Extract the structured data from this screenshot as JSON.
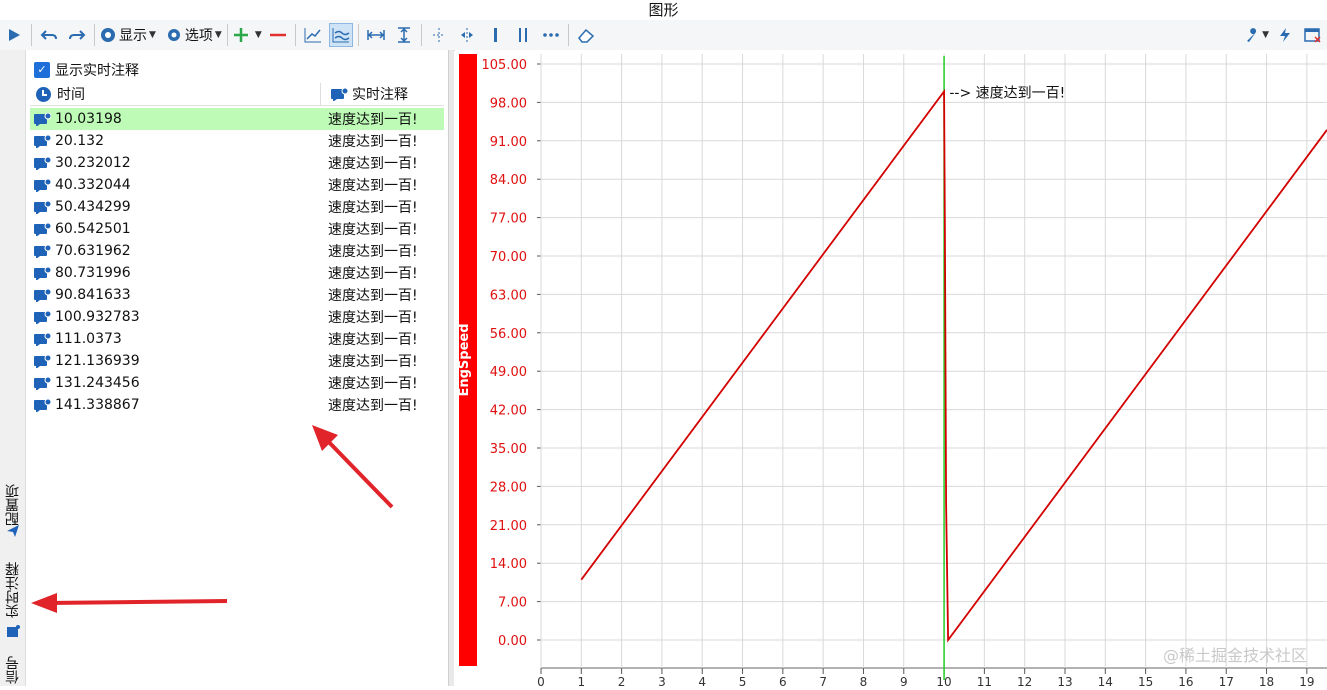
{
  "window": {
    "title": "图形"
  },
  "toolbar": {
    "display_label": "显示",
    "options_label": "选项",
    "icons": [
      "play-icon",
      "undo-icon",
      "redo-icon",
      "display-icon",
      "options-gear-icon",
      "add-icon",
      "remove-icon",
      "line-chart-icon",
      "multi-line-icon",
      "fit-width-icon",
      "fit-height-icon",
      "cursor-icon",
      "cursor-cross-icon",
      "single-bar-icon",
      "double-bar-icon",
      "more-icon",
      "eraser-icon",
      "wrench-icon",
      "lightning-icon",
      "close-window-icon"
    ]
  },
  "side_tabs": {
    "config": "配置项",
    "realtime_annot": "实时注释",
    "signal": "信号"
  },
  "annotations": {
    "show_checkbox_label": "显示实时注释",
    "col_time": "时间",
    "col_note": "实时注释",
    "rows": [
      {
        "time": "10.03198",
        "note": "速度达到一百!"
      },
      {
        "time": "20.132",
        "note": "速度达到一百!"
      },
      {
        "time": "30.232012",
        "note": "速度达到一百!"
      },
      {
        "time": "40.332044",
        "note": "速度达到一百!"
      },
      {
        "time": "50.434299",
        "note": "速度达到一百!"
      },
      {
        "time": "60.542501",
        "note": "速度达到一百!"
      },
      {
        "time": "70.631962",
        "note": "速度达到一百!"
      },
      {
        "time": "80.731996",
        "note": "速度达到一百!"
      },
      {
        "time": "90.841633",
        "note": "速度达到一百!"
      },
      {
        "time": "100.932783",
        "note": "速度达到一百!"
      },
      {
        "time": "111.0373",
        "note": "速度达到一百!"
      },
      {
        "time": "121.136939",
        "note": "速度达到一百!"
      },
      {
        "time": "131.243456",
        "note": "速度达到一百!"
      },
      {
        "time": "141.338867",
        "note": "速度达到一百!"
      }
    ]
  },
  "chart_data": {
    "type": "line",
    "ylabel": "EngSpeed",
    "ylim": [
      0,
      105
    ],
    "yticks": [
      "0.00",
      "7.00",
      "14.00",
      "21.00",
      "28.00",
      "35.00",
      "42.00",
      "49.00",
      "56.00",
      "63.00",
      "70.00",
      "77.00",
      "84.00",
      "91.00",
      "98.00",
      "105.00"
    ],
    "xlim": [
      0,
      19.5
    ],
    "xticks": [
      0,
      1,
      2,
      3,
      4,
      5,
      6,
      7,
      8,
      9,
      10,
      11,
      12,
      13,
      14,
      15,
      16,
      17,
      18,
      19
    ],
    "grid": true,
    "series": [
      {
        "color": "#d40000",
        "x": [
          1.0,
          10.0,
          10.02,
          10.05,
          10.1,
          19.5
        ],
        "y": [
          11,
          100,
          75,
          25,
          0,
          93
        ]
      }
    ],
    "cursor_x": 10.0,
    "cursor_color": "#22cc22",
    "annotation": {
      "x": 10.03198,
      "y": 100,
      "text": "--> 速度达到一百!"
    }
  },
  "watermark": "@稀土掘金技术社区"
}
